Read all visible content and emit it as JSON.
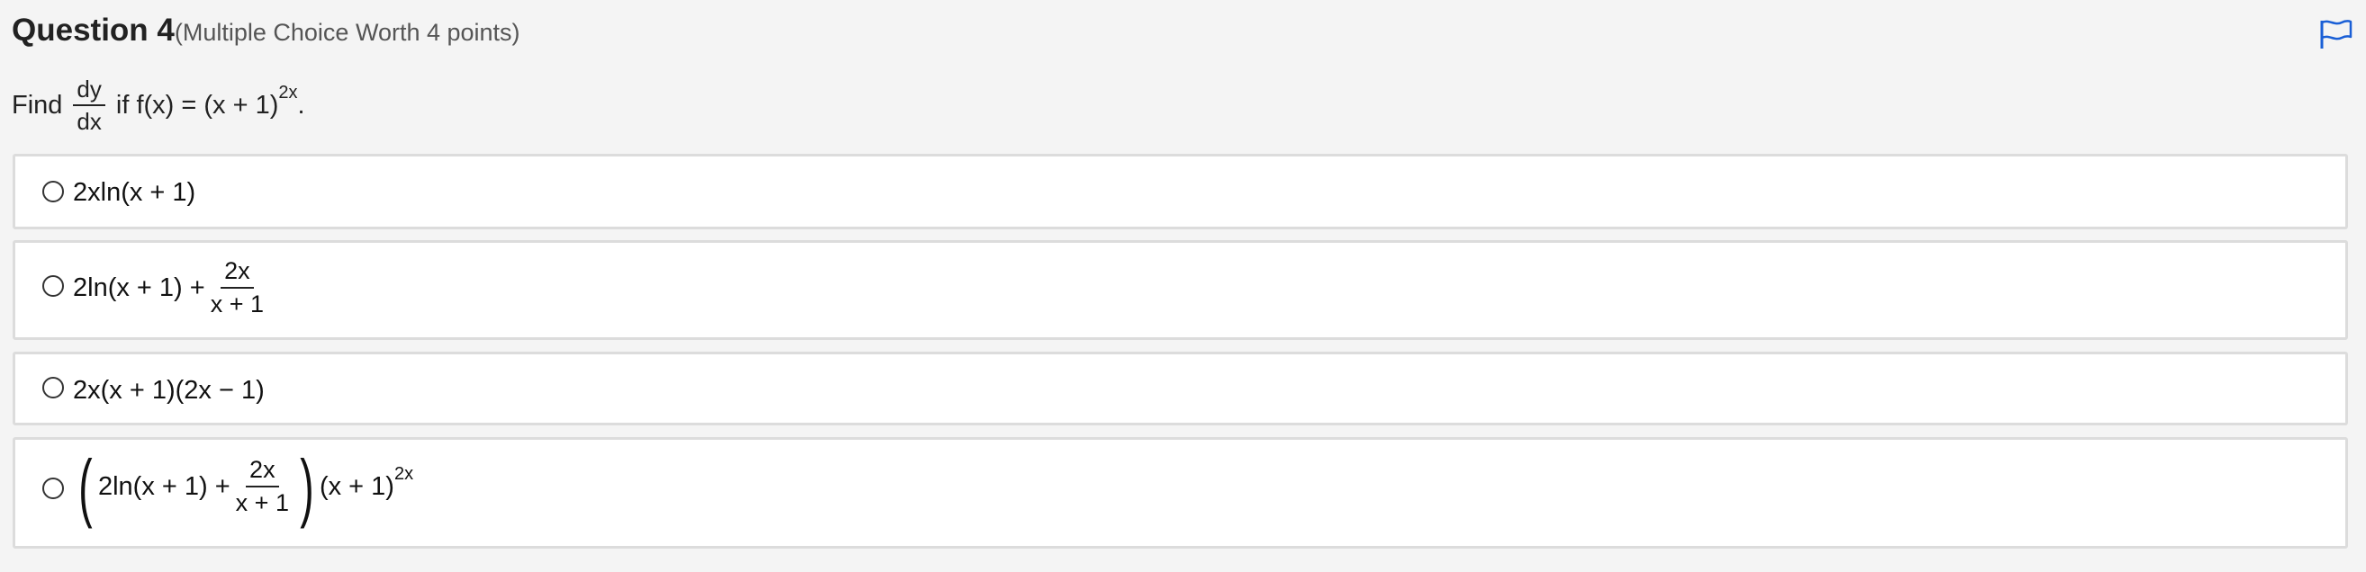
{
  "question": {
    "title": "Question 4",
    "subtitle": "(Multiple Choice Worth 4 points)",
    "flag_icon": "flag-icon",
    "prompt_find": "Find",
    "deriv_num": "dy",
    "deriv_den": "dx",
    "prompt_rest": "if f(x) = (x + 1)",
    "prompt_exp": "2x",
    "prompt_end": "."
  },
  "options": [
    {
      "text": "2xln(x + 1)"
    },
    {
      "lead": "2ln(x + 1) + ",
      "num": "2x",
      "den": "x + 1"
    },
    {
      "text": "2x(x + 1)(2x − 1)"
    },
    {
      "open_paren": "(",
      "lead": "2ln(x + 1) + ",
      "num": "2x",
      "den": "x + 1",
      "close_paren": ")",
      "tail": "(x + 1)",
      "exp": "2x"
    }
  ],
  "colors": {
    "background": "#f4f4f4",
    "card": "#ffffff",
    "card_border": "#dcdcdc",
    "flag": "#1a5fd6"
  }
}
